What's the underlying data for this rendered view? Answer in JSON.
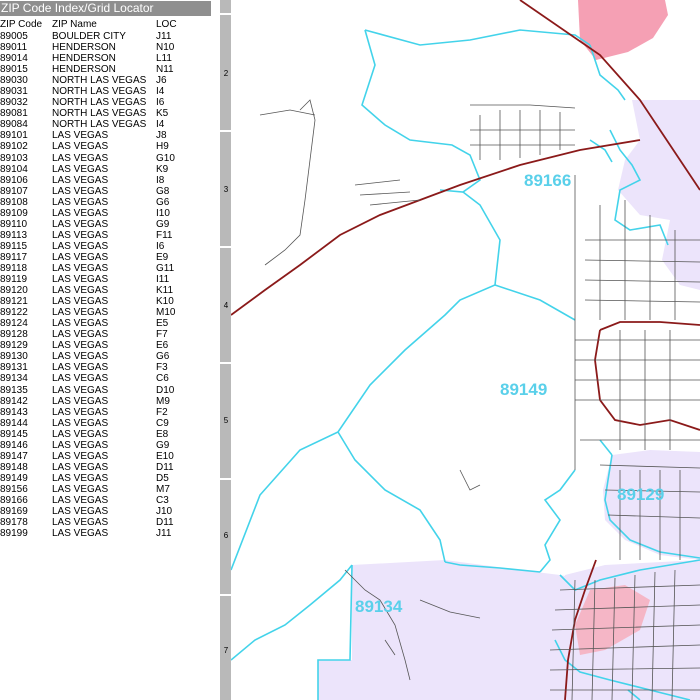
{
  "index": {
    "title": "ZIP Code Index/Grid Locator",
    "headers": {
      "zip": "ZIP Code",
      "name": "ZIP Name",
      "loc": "LOC"
    },
    "rows": [
      {
        "zip": "89005",
        "name": "BOULDER CITY",
        "loc": "J11"
      },
      {
        "zip": "89011",
        "name": "HENDERSON",
        "loc": "N10"
      },
      {
        "zip": "89014",
        "name": "HENDERSON",
        "loc": "L11"
      },
      {
        "zip": "89015",
        "name": "HENDERSON",
        "loc": "N11"
      },
      {
        "zip": "89030",
        "name": "NORTH LAS VEGAS",
        "loc": "J6"
      },
      {
        "zip": "89031",
        "name": "NORTH LAS VEGAS",
        "loc": "I4"
      },
      {
        "zip": "89032",
        "name": "NORTH LAS VEGAS",
        "loc": "I6"
      },
      {
        "zip": "89081",
        "name": "NORTH LAS VEGAS",
        "loc": "K5"
      },
      {
        "zip": "89084",
        "name": "NORTH LAS VEGAS",
        "loc": "I4"
      },
      {
        "zip": "89101",
        "name": "LAS VEGAS",
        "loc": "J8"
      },
      {
        "zip": "89102",
        "name": "LAS VEGAS",
        "loc": "H9"
      },
      {
        "zip": "89103",
        "name": "LAS VEGAS",
        "loc": "G10"
      },
      {
        "zip": "89104",
        "name": "LAS VEGAS",
        "loc": "K9"
      },
      {
        "zip": "89106",
        "name": "LAS VEGAS",
        "loc": "I8"
      },
      {
        "zip": "89107",
        "name": "LAS VEGAS",
        "loc": "G8"
      },
      {
        "zip": "89108",
        "name": "LAS VEGAS",
        "loc": "G6"
      },
      {
        "zip": "89109",
        "name": "LAS VEGAS",
        "loc": "I10"
      },
      {
        "zip": "89110",
        "name": "LAS VEGAS",
        "loc": "G9"
      },
      {
        "zip": "89113",
        "name": "LAS VEGAS",
        "loc": "F11"
      },
      {
        "zip": "89115",
        "name": "LAS VEGAS",
        "loc": "I6"
      },
      {
        "zip": "89117",
        "name": "LAS VEGAS",
        "loc": "E9"
      },
      {
        "zip": "89118",
        "name": "LAS VEGAS",
        "loc": "G11"
      },
      {
        "zip": "89119",
        "name": "LAS VEGAS",
        "loc": "I11"
      },
      {
        "zip": "89120",
        "name": "LAS VEGAS",
        "loc": "K11"
      },
      {
        "zip": "89121",
        "name": "LAS VEGAS",
        "loc": "K10"
      },
      {
        "zip": "89122",
        "name": "LAS VEGAS",
        "loc": "M10"
      },
      {
        "zip": "89124",
        "name": "LAS VEGAS",
        "loc": "E5"
      },
      {
        "zip": "89128",
        "name": "LAS VEGAS",
        "loc": "F7"
      },
      {
        "zip": "89129",
        "name": "LAS VEGAS",
        "loc": "E6"
      },
      {
        "zip": "89130",
        "name": "LAS VEGAS",
        "loc": "G6"
      },
      {
        "zip": "89131",
        "name": "LAS VEGAS",
        "loc": "F3"
      },
      {
        "zip": "89134",
        "name": "LAS VEGAS",
        "loc": "C6"
      },
      {
        "zip": "89135",
        "name": "LAS VEGAS",
        "loc": "D10"
      },
      {
        "zip": "89142",
        "name": "LAS VEGAS",
        "loc": "M9"
      },
      {
        "zip": "89143",
        "name": "LAS VEGAS",
        "loc": "F2"
      },
      {
        "zip": "89144",
        "name": "LAS VEGAS",
        "loc": "C9"
      },
      {
        "zip": "89145",
        "name": "LAS VEGAS",
        "loc": "E8"
      },
      {
        "zip": "89146",
        "name": "LAS VEGAS",
        "loc": "G9"
      },
      {
        "zip": "89147",
        "name": "LAS VEGAS",
        "loc": "E10"
      },
      {
        "zip": "89148",
        "name": "LAS VEGAS",
        "loc": "D11"
      },
      {
        "zip": "89149",
        "name": "LAS VEGAS",
        "loc": "D5"
      },
      {
        "zip": "89156",
        "name": "LAS VEGAS",
        "loc": "M7"
      },
      {
        "zip": "89166",
        "name": "LAS VEGAS",
        "loc": "C3"
      },
      {
        "zip": "89169",
        "name": "LAS VEGAS",
        "loc": "J10"
      },
      {
        "zip": "89178",
        "name": "LAS VEGAS",
        "loc": "D11"
      },
      {
        "zip": "89199",
        "name": "LAS VEGAS",
        "loc": "J11"
      }
    ]
  },
  "grid": {
    "rows": [
      "2",
      "3",
      "4",
      "5",
      "6",
      "7"
    ]
  },
  "map": {
    "zip_labels": [
      "89166",
      "89149",
      "89129",
      "89134"
    ],
    "colors": {
      "boundary": "#43d3ea",
      "zone_fill": "#ece4fb",
      "pink_zone": "#f5a0b4",
      "highway": "#8b1a1a",
      "street": "#555555"
    }
  }
}
